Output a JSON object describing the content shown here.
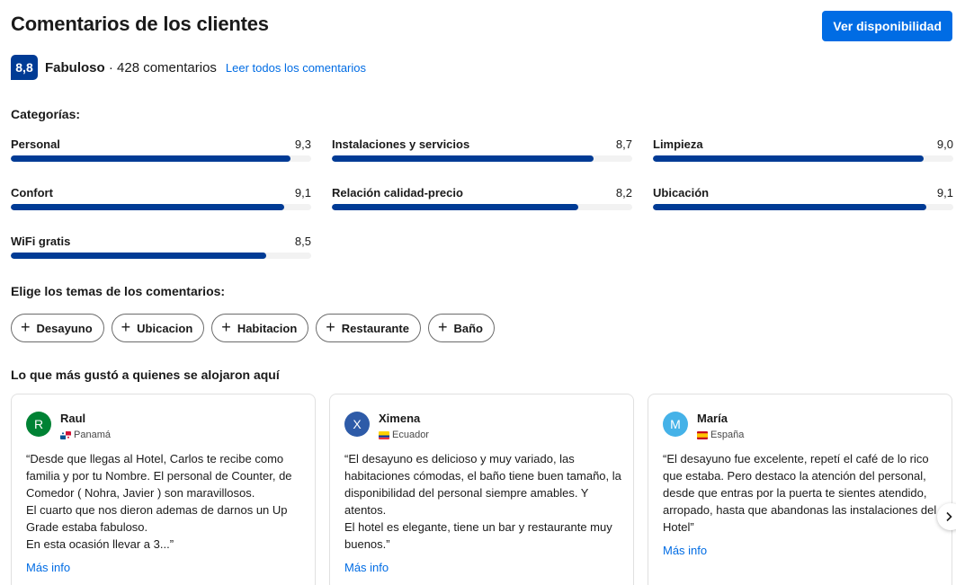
{
  "header": {
    "title": "Comentarios de los clientes",
    "cta_label": "Ver disponibilidad"
  },
  "summary": {
    "score": "8,8",
    "rating_word": "Fabuloso",
    "separator": " · ",
    "count": "428 comentarios",
    "read_all_link": "Leer todos los comentarios"
  },
  "categories": {
    "title": "Categorías:",
    "items": [
      {
        "label": "Personal",
        "value": "9,3",
        "score": 9.3
      },
      {
        "label": "Instalaciones y servicios",
        "value": "8,7",
        "score": 8.7
      },
      {
        "label": "Limpieza",
        "value": "9,0",
        "score": 9.0
      },
      {
        "label": "Confort",
        "value": "9,1",
        "score": 9.1
      },
      {
        "label": "Relación calidad-precio",
        "value": "8,2",
        "score": 8.2
      },
      {
        "label": "Ubicación",
        "value": "9,1",
        "score": 9.1
      },
      {
        "label": "WiFi gratis",
        "value": "8,5",
        "score": 8.5
      }
    ]
  },
  "topics": {
    "title": "Elige los temas de los comentarios:",
    "chips": [
      "Desayuno",
      "Ubicacion",
      "Habitacion",
      "Restaurante",
      "Baño"
    ]
  },
  "highlights": {
    "title": "Lo que más gustó a quienes se alojaron aquí",
    "more_label": "Más info",
    "reviews": [
      {
        "initial": "R",
        "avatar_color": "#008234",
        "name": "Raul",
        "country": "Panamá",
        "text": "“Desde que llegas al Hotel, Carlos te recibe como familia y por tu Nombre. El personal de Counter, de Comedor ( Nohra, Javier ) son maravillosos.\nEl cuarto que nos dieron ademas de darnos un Up Grade estaba fabuloso.\nEn esta ocasión llevar a 3...”"
      },
      {
        "initial": "X",
        "avatar_color": "#2e5ba8",
        "name": "Ximena",
        "country": "Ecuador",
        "text": "“El desayuno es delicioso y muy variado, las habitaciones cómodas, el baño tiene buen tamaño, la disponibilidad del personal siempre amables. Y atentos.\nEl hotel es elegante, tiene un bar y restaurante muy buenos.”"
      },
      {
        "initial": "M",
        "avatar_color": "#45b2e8",
        "name": "María",
        "country": "España",
        "text": "“El desayuno fue excelente, repetí el café de lo rico que estaba. Pero destaco la atención del personal, desde que entras por la puerta te sientes atendido, arropado, hasta que abandonas las instalaciones del Hotel”"
      }
    ]
  },
  "colors": {
    "brand_dark": "#003b95",
    "link": "#006ce4",
    "track": "#f2f2f2"
  },
  "icons": {
    "chip": "plus-icon",
    "carousel": "chevron-right-icon"
  }
}
